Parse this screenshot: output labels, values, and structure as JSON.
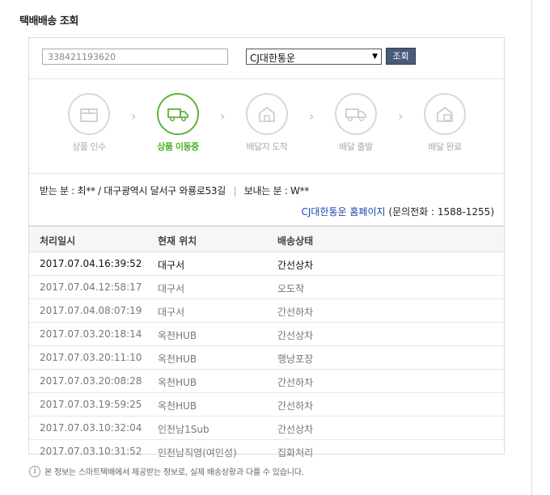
{
  "page": {
    "title": "택배배송 조회"
  },
  "search": {
    "tracking_number": "338421193620",
    "carrier_selected": "CJ대한통운",
    "lookup_label": "조회"
  },
  "steps": [
    {
      "label": "상품 인수",
      "icon": "box-icon",
      "active": false
    },
    {
      "label": "상품 이동중",
      "icon": "truck-icon",
      "active": true
    },
    {
      "label": "배달지 도착",
      "icon": "house-icon",
      "active": false
    },
    {
      "label": "배달 출발",
      "icon": "delivery-truck-icon",
      "active": false
    },
    {
      "label": "배달 완료",
      "icon": "house-box-icon",
      "active": false
    }
  ],
  "shipment": {
    "receiver_label": "받는 분 :",
    "receiver_value": "최** / 대구광역시 달서구 와룡로53길",
    "sender_label": "보내는 분 :",
    "sender_value": "W**",
    "carrier_link": "CJ대한통운 홈페이지",
    "phone_text": "(문의전화 : 1588-1255)"
  },
  "table": {
    "headers": [
      "처리일시",
      "현재 위치",
      "배송상태"
    ],
    "rows": [
      [
        "2017.07.04.16:39:52",
        "대구서",
        "간선상차"
      ],
      [
        "2017.07.04.12:58:17",
        "대구서",
        "오도착"
      ],
      [
        "2017.07.04.08:07:19",
        "대구서",
        "간선하차"
      ],
      [
        "2017.07.03.20:18:14",
        "옥천HUB",
        "간선상차"
      ],
      [
        "2017.07.03.20:11:10",
        "옥천HUB",
        "행낭포장"
      ],
      [
        "2017.07.03.20:08:28",
        "옥천HUB",
        "간선하차"
      ],
      [
        "2017.07.03.19:59:25",
        "옥천HUB",
        "간선하차"
      ],
      [
        "2017.07.03.10:32:04",
        "인천남1Sub",
        "간선상차"
      ],
      [
        "2017.07.03.10:31:52",
        "인천남직영(여인성)",
        "집화처리"
      ]
    ]
  },
  "note": "본 정보는 스마트택배에서 제공받는 정보로, 실제 배송상황과 다를 수 있습니다.",
  "colors": {
    "active_green": "#5fb13f",
    "button_navy": "#4a5a78",
    "link_blue": "#1a45b0"
  }
}
